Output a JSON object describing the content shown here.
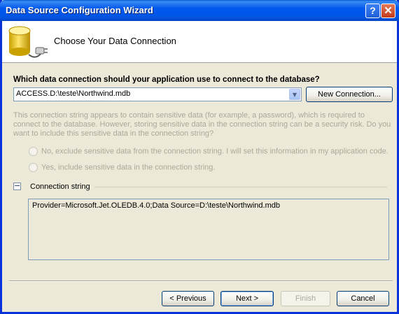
{
  "window": {
    "title": "Data Source Configuration Wizard",
    "help_label": "?",
    "close_label": "✕"
  },
  "header": {
    "title": "Choose Your Data Connection",
    "icon": "database-plug-icon"
  },
  "connection": {
    "question": "Which data connection should your application use to connect to the database?",
    "selected": "ACCESS.D:\\teste\\Northwind.mdb",
    "new_connection_label": "New Connection..."
  },
  "sensitive": {
    "warning": "This connection string appears to contain sensitive data (for example, a password), which is required to connect to the database. However, storing sensitive data in the connection string can be a security risk. Do you want to include this sensitive data in the connection string?",
    "option_exclude": "No, exclude sensitive data from the connection string. I will set this information in my application code.",
    "option_include": "Yes, include sensitive data in the connection string."
  },
  "connection_string": {
    "label": "Connection string",
    "value": "Provider=Microsoft.Jet.OLEDB.4.0;Data Source=D:\\teste\\Northwind.mdb",
    "expander": "−"
  },
  "buttons": {
    "previous": "< Previous",
    "next": "Next >",
    "finish": "Finish",
    "cancel": "Cancel"
  },
  "colors": {
    "titlebar": "#0058ee",
    "dialog_bg": "#ece9d8",
    "disabled_text": "#aca899"
  }
}
